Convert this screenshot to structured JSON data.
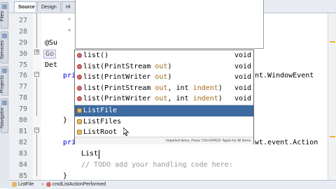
{
  "left_strip": {
    "tabs": [
      {
        "label": "Files"
      },
      {
        "label": "Services"
      },
      {
        "label": "Projects"
      },
      {
        "label": "Navigator"
      }
    ]
  },
  "top_tabs": {
    "source": "Source",
    "design": "Design",
    "history": "Hi"
  },
  "line_numbers": [
    "27",
    "28",
    "29",
    "30",
    "75",
    "76",
    "77",
    "78",
    "79",
    "80",
    "81",
    "82",
    "83",
    "84",
    "85",
    "86"
  ],
  "code_lines": {
    "l29_prefix": "@Su",
    "l30_folded": "Go",
    "l75_text": "Det",
    "l76_kw": "pri",
    "l76_tail": "nt.WindowEvent",
    "l80_kw": "pri",
    "l80_tail": "wt.event.Action",
    "l83_text": "List",
    "l84_comment": "// TODO add your handling code here:",
    "l85_text": "}"
  },
  "completion": {
    "items": [
      {
        "name": "list",
        "sig": "()",
        "ret": "void",
        "kind": "method"
      },
      {
        "name": "list",
        "sig": "(PrintStream ",
        "param": "out",
        "tail": ")",
        "ret": "void",
        "kind": "method"
      },
      {
        "name": "list",
        "sig": "(PrintWriter ",
        "param": "out",
        "tail": ")",
        "ret": "void",
        "kind": "method"
      },
      {
        "name": "list",
        "sig": "(PrintStream ",
        "param": "out",
        "mid": ", int ",
        "param2": "indent",
        "tail": ")",
        "ret": "void",
        "kind": "method"
      },
      {
        "name": "list",
        "sig": "(PrintWriter ",
        "param": "out",
        "mid": ", int ",
        "param2": "indent",
        "tail": ")",
        "ret": "void",
        "kind": "method"
      },
      {
        "name": "ListFile",
        "kind": "class",
        "selected": true
      },
      {
        "name": "ListFiles",
        "kind": "class"
      },
      {
        "name": "ListRoot",
        "kind": "class"
      }
    ],
    "hint": "Imported Items, Press 'Ctrl+SPACE' Again for All Items"
  },
  "status": {
    "crumb1": "ListFile",
    "crumb2": "cmdListActionPerformed"
  },
  "colors": {
    "selection": "#3d6aa0",
    "keyword": "#0000e6",
    "comment": "#969696",
    "param": "#a06a1a"
  }
}
